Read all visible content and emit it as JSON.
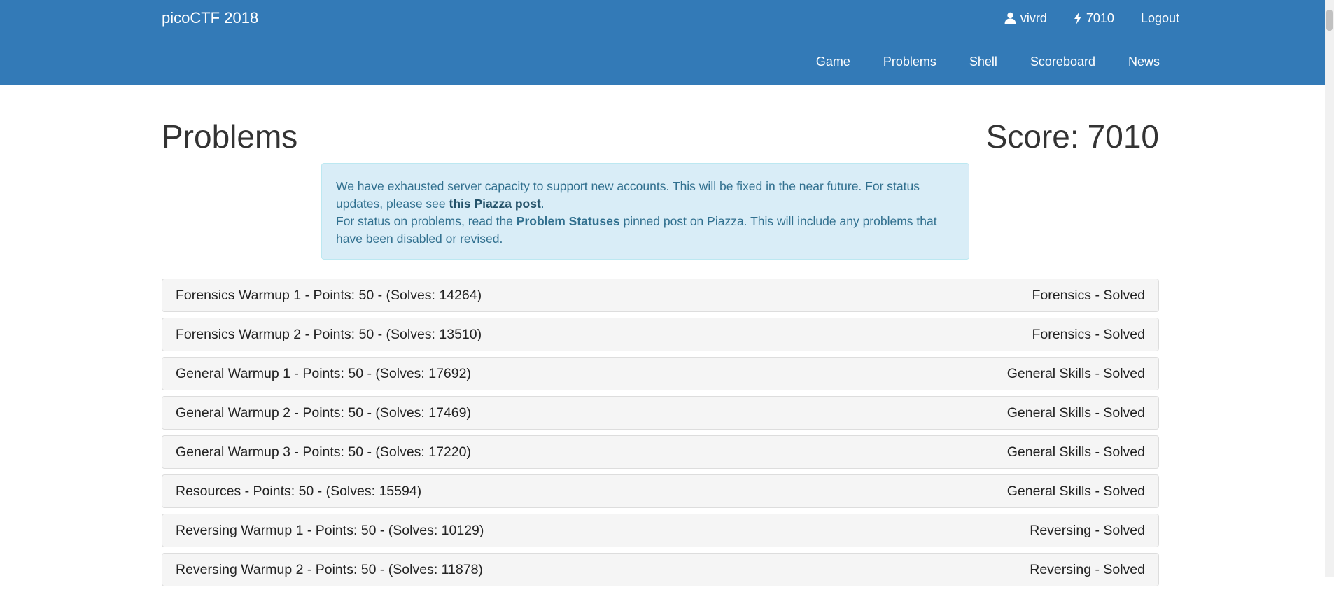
{
  "navbar": {
    "brand": "picoCTF 2018",
    "user": {
      "icon": "user-icon",
      "name": "vivrd"
    },
    "points": {
      "icon": "bolt-icon",
      "value": "7010"
    },
    "logout": "Logout",
    "menu": [
      {
        "label": "Game"
      },
      {
        "label": "Problems"
      },
      {
        "label": "Shell"
      },
      {
        "label": "Scoreboard"
      },
      {
        "label": "News"
      }
    ],
    "color": "#337ab7"
  },
  "page": {
    "title": "Problems",
    "score_label": "Score:",
    "score_value": "7010"
  },
  "notice": {
    "line1_pre": "We have exhausted server capacity to support new accounts. This will be fixed in the near future. For status updates, please see ",
    "line1_link": "this Piazza post",
    "line1_post": ".",
    "line2_pre": "For status on problems, read the ",
    "line2_bold": "Problem Statuses",
    "line2_post": " pinned post on Piazza. This will include any problems that have been disabled or revised.",
    "bg_color": "#d9edf7",
    "text_color": "#31708f"
  },
  "problems": [
    {
      "title": "Forensics Warmup 1 - Points: 50 - (Solves: 14264)",
      "status": "Forensics - Solved"
    },
    {
      "title": "Forensics Warmup 2 - Points: 50 - (Solves: 13510)",
      "status": "Forensics - Solved"
    },
    {
      "title": "General Warmup 1 - Points: 50 - (Solves: 17692)",
      "status": "General Skills - Solved"
    },
    {
      "title": "General Warmup 2 - Points: 50 - (Solves: 17469)",
      "status": "General Skills - Solved"
    },
    {
      "title": "General Warmup 3 - Points: 50 - (Solves: 17220)",
      "status": "General Skills - Solved"
    },
    {
      "title": "Resources - Points: 50 - (Solves: 15594)",
      "status": "General Skills - Solved"
    },
    {
      "title": "Reversing Warmup 1 - Points: 50 - (Solves: 10129)",
      "status": "Reversing - Solved"
    },
    {
      "title": "Reversing Warmup 2 - Points: 50 - (Solves: 11878)",
      "status": "Reversing - Solved"
    }
  ]
}
